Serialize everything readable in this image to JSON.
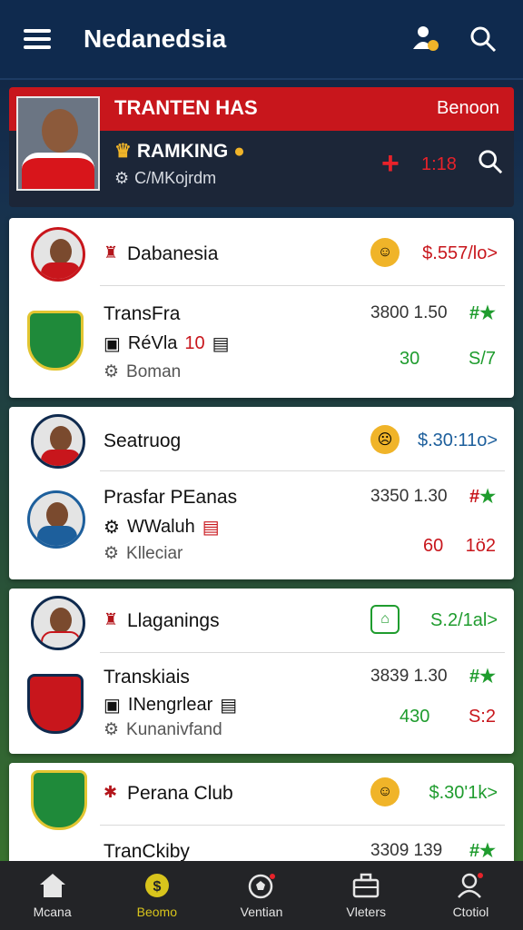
{
  "header": {
    "title": "Nedanedsia"
  },
  "hero": {
    "banner_title": "TRANTEN HAS",
    "banner_right": "Benoon",
    "ranking_label": "RAMKING",
    "sub_label": "C/MKojrdm",
    "score": "1:18"
  },
  "cards": [
    {
      "team_name": "Dabanesia",
      "price": "$.557/lo>",
      "price_color": "#c8161c",
      "player_name": "TransFra",
      "stats": "3800  1.50",
      "line2_text": "RéVla",
      "line2_num": "10",
      "line3_text": "Boman",
      "num_a": "30",
      "num_a_color": "#1f9c2e",
      "num_b": "S/7",
      "num_b_color": "#1f9c2e"
    },
    {
      "team_name": "Seatruog",
      "price": "$.30:11o>",
      "price_color": "#1d5f9c",
      "player_name": "Prasfar PEanas",
      "stats": "3350  1.30",
      "line2_text": "WWaluh",
      "line3_text": "Klleciar",
      "num_a": "60",
      "num_a_color": "#c8161c",
      "num_b": "1ö2",
      "num_b_color": "#c8161c"
    },
    {
      "team_name": "Llaganings",
      "price": "S.2/1al>",
      "price_color": "#1f9c2e",
      "player_name": "Transkiais",
      "stats": "3839  1.30",
      "line2_text": "INengrlear",
      "line3_text": "Kunanivfand",
      "num_a": "430",
      "num_a_color": "#1f9c2e",
      "num_b": "S:2",
      "num_b_color": "#c8161c"
    },
    {
      "team_name": "Perana Club",
      "price": "$.30'1k>",
      "price_color": "#1f9c2e",
      "player_name": "TranCkiby",
      "stats": "3309  139"
    }
  ],
  "bottom_nav": [
    {
      "label": "Mcana",
      "icon": "home-icon"
    },
    {
      "label": "Beomo",
      "icon": "token-icon",
      "active": true
    },
    {
      "label": "Ventian",
      "icon": "soccer-ball-icon"
    },
    {
      "label": "Vleters",
      "icon": "briefcase-icon"
    },
    {
      "label": "Ctotiol",
      "icon": "profile-icon"
    }
  ]
}
